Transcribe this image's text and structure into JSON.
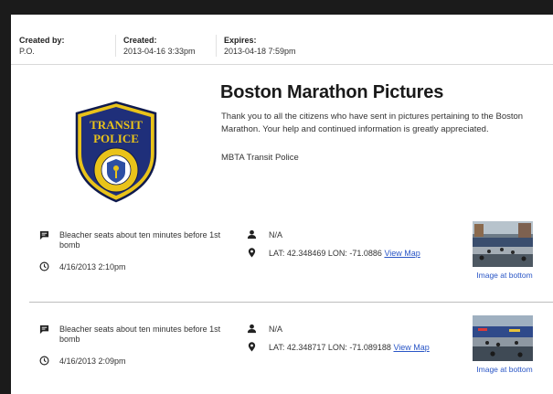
{
  "meta": {
    "created_by_label": "Created by:",
    "created_by_value": "P.O.",
    "created_label": "Created:",
    "created_value": "2013-04-16 3:33pm",
    "expires_label": "Expires:",
    "expires_value": "2013-04-18 7:59pm"
  },
  "post": {
    "title": "Boston Marathon Pictures",
    "description": "Thank you to all the citizens who have sent in pictures pertaining to the Boston Marathon. Your help and continued information is greatly appreciated.",
    "org": "MBTA Transit Police"
  },
  "badge": {
    "line1": "TRANSIT",
    "line2": "POLICE",
    "ring_top": "MASSACHUSETTS BAY",
    "ring_bottom": "TRANSPORTATION AUTHORITY",
    "colors": {
      "field": "#1f2f7a",
      "gold": "#e9c31a",
      "outline": "#0f1a4d"
    }
  },
  "entries": [
    {
      "caption": "Bleacher seats about ten minutes before 1st bomb",
      "datetime": "4/16/2013 2:10pm",
      "user": "N/A",
      "location": "LAT: 42.348469 LON: -71.0886",
      "map_link": "View Map",
      "image_caption": "Image at bottom",
      "icons": [
        "comment-icon",
        "clock-icon",
        "person-icon",
        "pin-icon"
      ]
    },
    {
      "caption": "Bleacher seats about ten minutes before 1st bomb",
      "datetime": "4/16/2013 2:09pm",
      "user": "N/A",
      "location": "LAT: 42.348717 LON: -71.089188",
      "map_link": "View Map",
      "image_caption": "Image at bottom",
      "icons": [
        "comment-icon",
        "clock-icon",
        "person-icon",
        "pin-icon"
      ]
    }
  ],
  "colors": {
    "link": "#2a56c6",
    "frame_bg": "#1b1b1b"
  }
}
